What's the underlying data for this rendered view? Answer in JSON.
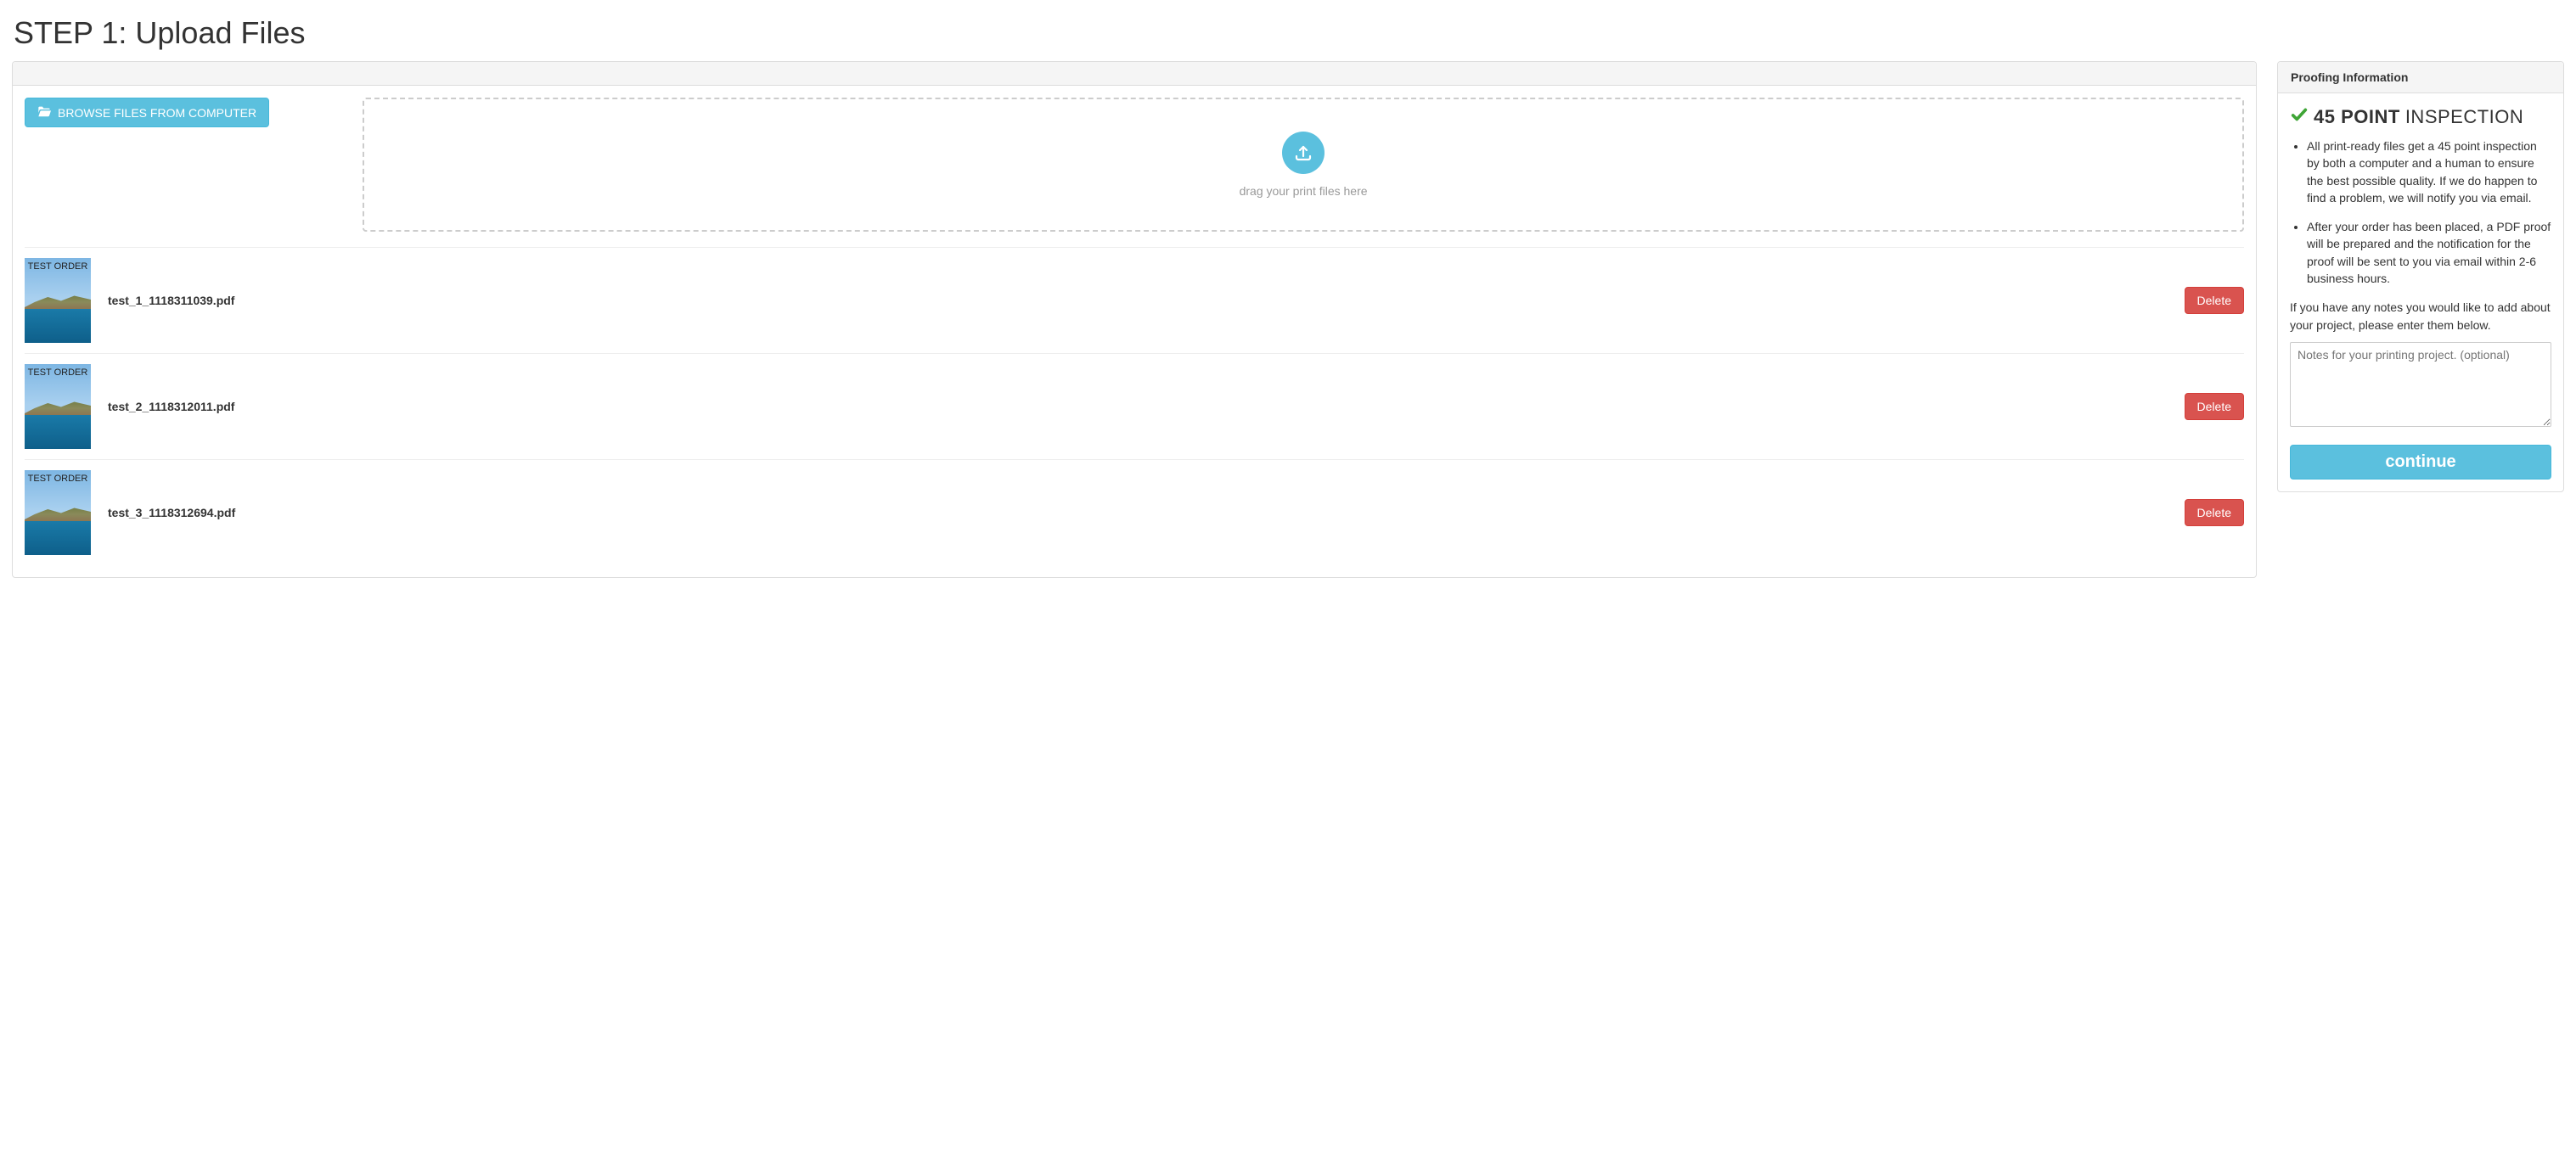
{
  "page_title": "STEP 1: Upload Files",
  "browse_button_label": "BROWSE FILES FROM COMPUTER",
  "dropzone_hint": "drag your print files here",
  "thumb_label": "TEST ORDER",
  "files": [
    {
      "name": "test_1_1118311039.pdf"
    },
    {
      "name": "test_2_1118312011.pdf"
    },
    {
      "name": "test_3_1118312694.pdf"
    }
  ],
  "delete_label": "Delete",
  "sidebar": {
    "header": "Proofing Information",
    "inspection_bold": "45 POINT",
    "inspection_light": "INSPECTION",
    "bullets": [
      "All print-ready files get a 45 point inspection by both a computer and a human to ensure the best possible quality. If we do happen to find a problem, we will notify you via email.",
      "After your order has been placed, a PDF proof will be prepared and the notification for the proof will be sent to you via email within 2-6 business hours."
    ],
    "notes_prompt": "If you have any notes you would like to add about your project, please enter them below.",
    "notes_placeholder": "Notes for your printing project. (optional)",
    "continue_label": "continue"
  }
}
